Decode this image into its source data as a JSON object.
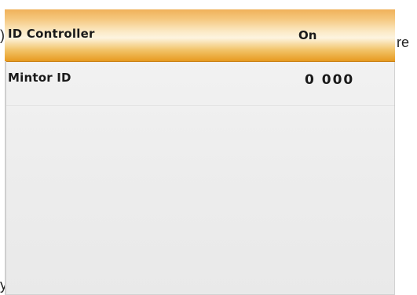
{
  "fragments": {
    "left": ")",
    "right": "re",
    "bottom": "y"
  },
  "menu": {
    "rows": [
      {
        "label": "ID Controller",
        "value": "On",
        "selected": true
      },
      {
        "label": "Mintor ID",
        "value": "0 000",
        "selected": false
      }
    ]
  },
  "colors": {
    "highlight_top": "#f0b15a",
    "highlight_mid": "#fdf4e0",
    "highlight_bottom": "#e79a20",
    "screen_background": "#eeeeee",
    "text": "#1a1a1a"
  }
}
